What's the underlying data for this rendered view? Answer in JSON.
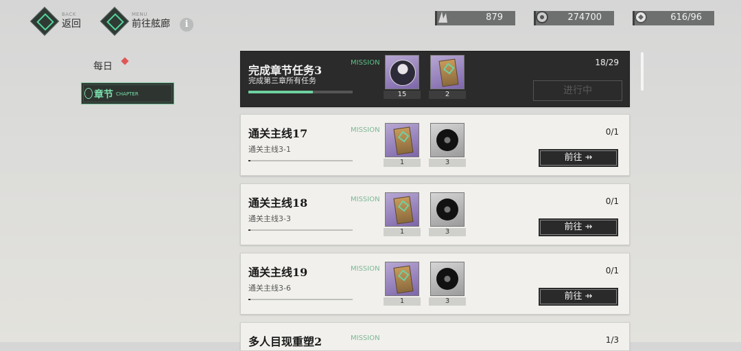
{
  "nav": {
    "back": {
      "en": "BACK",
      "zh": "返回"
    },
    "menu": {
      "en": "MENU",
      "zh": "前往舷廊"
    },
    "info": "i"
  },
  "resources": [
    {
      "icon": "crystal-icon",
      "value": "879"
    },
    {
      "icon": "coin-icon",
      "value": "274700"
    },
    {
      "icon": "stamina-icon",
      "value": "616/96"
    }
  ],
  "tabs": {
    "daily": "每日",
    "chapter": {
      "zh": "章节",
      "en": "CHAPTER"
    }
  },
  "missions": [
    {
      "title": "完成章节任务3",
      "desc": "完成第三章所有任务",
      "tag": "MISSION",
      "count": "18/29",
      "progress": 0.62,
      "status": "进行中",
      "rewards": [
        {
          "icon": "character-avatar-icon",
          "qty": "15"
        },
        {
          "icon": "ticket-icon",
          "qty": "2"
        }
      ]
    },
    {
      "title": "通关主线17",
      "desc": "通关主线3-1",
      "tag": "MISSION",
      "count": "0/1",
      "progress": 0.0,
      "button": "前往",
      "rewards": [
        {
          "icon": "ticket-icon",
          "qty": "1"
        },
        {
          "icon": "vinyl-record-icon",
          "qty": "3"
        }
      ]
    },
    {
      "title": "通关主线18",
      "desc": "通关主线3-3",
      "tag": "MISSION",
      "count": "0/1",
      "progress": 0.0,
      "button": "前往",
      "rewards": [
        {
          "icon": "ticket-icon",
          "qty": "1"
        },
        {
          "icon": "vinyl-record-icon",
          "qty": "3"
        }
      ]
    },
    {
      "title": "通关主线19",
      "desc": "通关主线3-6",
      "tag": "MISSION",
      "count": "0/1",
      "progress": 0.0,
      "button": "前往",
      "rewards": [
        {
          "icon": "ticket-icon",
          "qty": "1"
        },
        {
          "icon": "vinyl-record-icon",
          "qty": "3"
        }
      ]
    },
    {
      "title": "多人目现重塑2",
      "tag": "MISSION",
      "count": "1/3"
    }
  ],
  "colors": {
    "accent": "#5bc38a",
    "dark_card": "#2b2b2b",
    "light_card": "#f1f0ec"
  }
}
